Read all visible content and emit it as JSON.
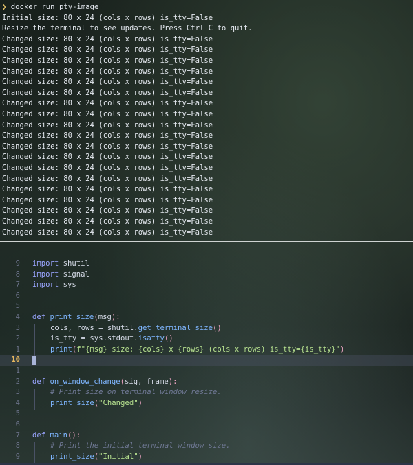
{
  "terminal": {
    "prompt_symbol": "❯",
    "command": "docker run pty-image",
    "output": [
      "Initial size: 80 x 24 (cols x rows) is_tty=False",
      "Resize the terminal to see updates. Press Ctrl+C to quit.",
      "Changed size: 80 x 24 (cols x rows) is_tty=False",
      "Changed size: 80 x 24 (cols x rows) is_tty=False",
      "Changed size: 80 x 24 (cols x rows) is_tty=False",
      "Changed size: 80 x 24 (cols x rows) is_tty=False",
      "Changed size: 80 x 24 (cols x rows) is_tty=False",
      "Changed size: 80 x 24 (cols x rows) is_tty=False",
      "Changed size: 80 x 24 (cols x rows) is_tty=False",
      "Changed size: 80 x 24 (cols x rows) is_tty=False",
      "Changed size: 80 x 24 (cols x rows) is_tty=False",
      "Changed size: 80 x 24 (cols x rows) is_tty=False",
      "Changed size: 80 x 24 (cols x rows) is_tty=False",
      "Changed size: 80 x 24 (cols x rows) is_tty=False",
      "Changed size: 80 x 24 (cols x rows) is_tty=False",
      "Changed size: 80 x 24 (cols x rows) is_tty=False",
      "Changed size: 80 x 24 (cols x rows) is_tty=False",
      "Changed size: 80 x 24 (cols x rows) is_tty=False",
      "Changed size: 80 x 24 (cols x rows) is_tty=False",
      "Changed size: 80 x 24 (cols x rows) is_tty=False",
      "Changed size: 80 x 24 (cols x rows) is_tty=False"
    ]
  },
  "editor": {
    "line_numbers": [
      "9",
      "8",
      "7",
      "6",
      "5",
      "4",
      "3",
      "2",
      "1",
      "10",
      "1",
      "2",
      "3",
      "4",
      "5",
      "6",
      "7",
      "8",
      "9"
    ],
    "current_line_number": "10",
    "code": {
      "l1_kw": "import",
      "l1_mod": " shutil",
      "l2_kw": "import",
      "l2_mod": " signal",
      "l3_kw": "import",
      "l3_mod": " sys",
      "l6_kw": "def",
      "l6_fn": "print_size",
      "l6_p1": "(",
      "l6_arg": "msg",
      "l6_p2": "):",
      "l7_a": "cols, rows = shutil.",
      "l7_fn": "get_terminal_size",
      "l7_p": "()",
      "l8_a": "is_tty = sys.stdout.",
      "l8_fn": "isatty",
      "l8_p": "()",
      "l9_fn": "print",
      "l9_p1": "(",
      "l9_str": "f\"{msg} size: {cols} x {rows} (cols x rows) is_tty={is_tty}\"",
      "l9_p2": ")",
      "l12_kw": "def",
      "l12_fn": "on_window_change",
      "l12_p1": "(",
      "l12_args": "sig, frame",
      "l12_p2": "):",
      "l13_cm": "# Print size on terminal window resize.",
      "l14_fn": "print_size",
      "l14_p1": "(",
      "l14_str": "\"Changed\"",
      "l14_p2": ")",
      "l17_kw": "def",
      "l17_fn": "main",
      "l17_p": "():",
      "l18_cm": "# Print the initial terminal window size.",
      "l19_fn": "print_size",
      "l19_p1": "(",
      "l19_str": "\"Initial\"",
      "l19_p2": ")"
    }
  },
  "colors": {
    "prompt": "#e6c36a",
    "keyword": "#9aa5ff",
    "function": "#7fb6ff",
    "string": "#b7e18f",
    "comment": "#6f7894",
    "current_line_number": "#e6b75f"
  }
}
